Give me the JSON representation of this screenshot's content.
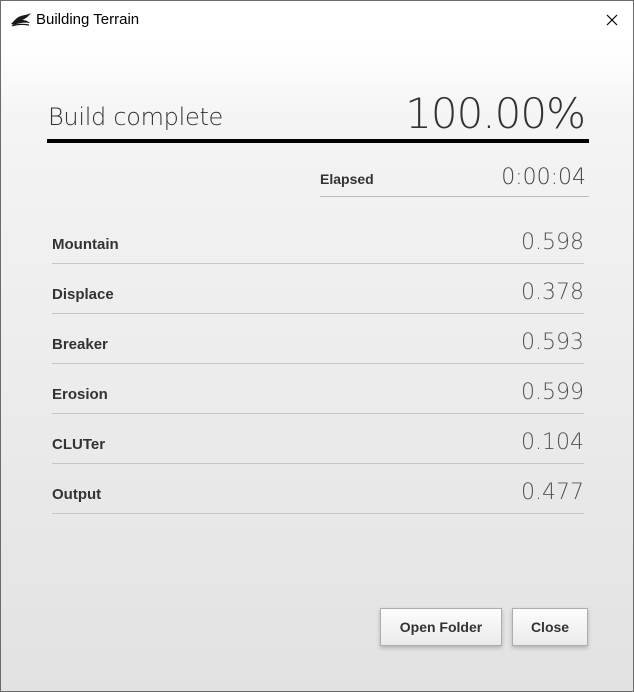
{
  "window": {
    "title": "Building Terrain",
    "app_icon": "terrain-logo-icon",
    "close_icon": "close-icon"
  },
  "status": {
    "heading": "Build complete",
    "percent": "100.00%",
    "progress": 1.0
  },
  "elapsed": {
    "label": "Elapsed",
    "value": "0:00:04"
  },
  "nodes": [
    {
      "label": "Mountain",
      "value": "0.598"
    },
    {
      "label": "Displace",
      "value": "0.378"
    },
    {
      "label": "Breaker",
      "value": "0.593"
    },
    {
      "label": "Erosion",
      "value": "0.599"
    },
    {
      "label": "CLUTer",
      "value": "0.104"
    },
    {
      "label": "Output",
      "value": "0.477"
    }
  ],
  "buttons": {
    "open_folder": "Open Folder",
    "close": "Close"
  }
}
